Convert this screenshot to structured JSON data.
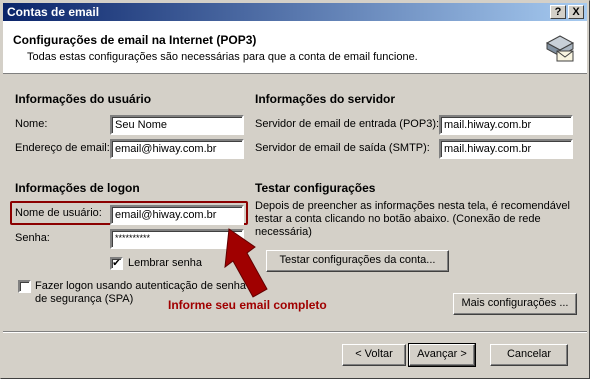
{
  "window": {
    "title": "Contas de email",
    "help_btn": "?",
    "close_btn": "X"
  },
  "header": {
    "title": "Configurações de email na Internet (POP3)",
    "subtitle": "Todas estas configurações são necessárias para que a conta de email funcione."
  },
  "user_info": {
    "heading": "Informações do usuário",
    "name_label": "Nome:",
    "name_value": "Seu Nome",
    "email_label": "Endereço de email:",
    "email_value": "email@hiway.com.br"
  },
  "server_info": {
    "heading": "Informações do servidor",
    "incoming_label": "Servidor de email de entrada (POP3):",
    "incoming_value": "mail.hiway.com.br",
    "outgoing_label": "Servidor de email de saída (SMTP):",
    "outgoing_value": "mail.hiway.com.br"
  },
  "logon_info": {
    "heading": "Informações de logon",
    "username_label": "Nome de usuário:",
    "username_value": "email@hiway.com.br",
    "password_label": "Senha:",
    "password_value": "**********",
    "remember_label": "Lembrar senha",
    "spa_label_line1": "Fazer logon usando autenticação de senha",
    "spa_label_line2": "de segurança (SPA)"
  },
  "test": {
    "heading": "Testar configurações",
    "description": "Depois de preencher as informações nesta tela, é recomendável testar a conta clicando no botão abaixo. (Conexão de rede necessária)",
    "test_button": "Testar configurações da conta..."
  },
  "annotation": {
    "text": "Informe seu email completo",
    "color": "#a00000"
  },
  "buttons": {
    "more_settings": "Mais configurações ...",
    "back": "< Voltar",
    "next": "Avançar >",
    "cancel": "Cancelar"
  }
}
